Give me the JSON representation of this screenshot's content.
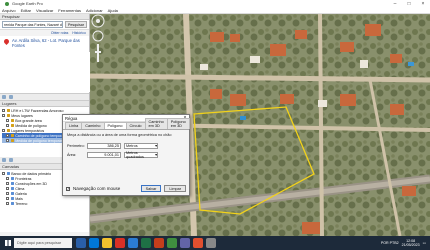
{
  "window": {
    "title": "Google Earth Pro"
  },
  "menu": [
    "Arquivo",
    "Editar",
    "Visualizar",
    "Ferramentas",
    "Adicionar",
    "Ajuda"
  ],
  "sidebar": {
    "search_header": "Pesquisar",
    "search_value": "renida Parque das Fontes, Nazaré da",
    "search_button": "Pesquisar",
    "history_link": "Histórico",
    "rows_link": "Obter rotas",
    "result_address": "Av. Ardila Silva, 62 - Lot. Parque das Fontes",
    "places_header": "Lugares",
    "places": [
      {
        "label": "LRH e LTW Fazzendas Amoroso",
        "level": 0,
        "state": ""
      },
      {
        "label": "Meus lugares",
        "level": 0,
        "state": ""
      },
      {
        "label": "Box grande área",
        "level": 1,
        "state": ""
      },
      {
        "label": "Medida de polígono",
        "level": 1,
        "state": ""
      },
      {
        "label": "Lugares temporários",
        "level": 0,
        "state": ""
      },
      {
        "label": "Caminho de polígono temporário",
        "level": 1,
        "state": "sel"
      },
      {
        "label": "Medida de polígono temporário",
        "level": 1,
        "state": "sel2"
      }
    ],
    "layers_header": "Camadas",
    "layers": [
      {
        "label": "Banco de dados primário",
        "level": 0
      },
      {
        "label": "Fronteiras",
        "level": 1
      },
      {
        "label": "Construções em 3D",
        "level": 1
      },
      {
        "label": "Clima",
        "level": 1
      },
      {
        "label": "Galeria",
        "level": 1
      },
      {
        "label": "Mais",
        "level": 1
      },
      {
        "label": "Terreno",
        "level": 1
      }
    ]
  },
  "dialog": {
    "title": "Régua",
    "tabs": [
      "Linha",
      "Caminho",
      "Polígono",
      "Círculo",
      "Caminho em 3D",
      "Polígono em 3D"
    ],
    "active_tab": "Polígono",
    "description": "Meça a distância ou a área de uma forma geométrica no chão",
    "perimeter_label": "Perímetro:",
    "perimeter_value": "386,25",
    "perimeter_unit": "Metros",
    "area_label": "Área:",
    "area_value": "9.001,01",
    "area_unit": "Metros quadrados",
    "nav_mouse_label": "Navegação com mouse",
    "save_button": "Salvar",
    "clear_button": "Limpar"
  },
  "taskbar": {
    "search_placeholder": "Digite aqui para pesquisar",
    "time": "12:08",
    "date": "21/05/2023",
    "lang": "POR PTB2"
  },
  "colors": {
    "accent": "#3e73c4",
    "polygon": "#f2d21a",
    "taskbar": "#1d2a3a"
  }
}
